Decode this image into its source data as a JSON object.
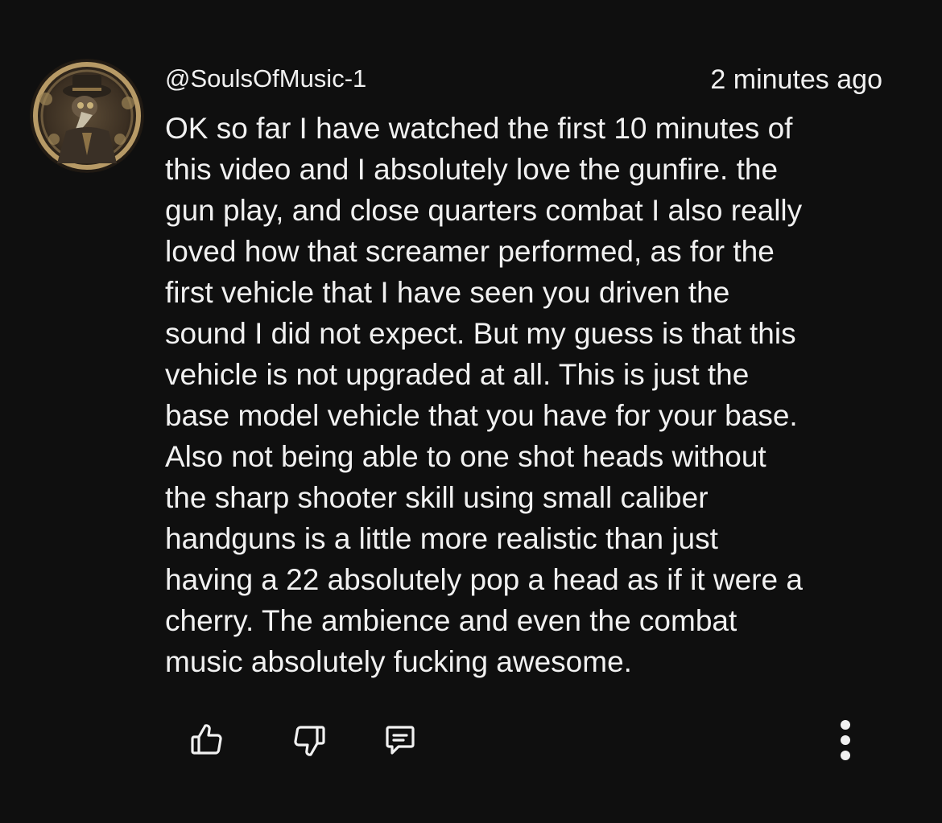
{
  "comment": {
    "author": "@SoulsOfMusic-1",
    "timestamp": "2 minutes ago",
    "avatar_icon": "plague-doctor-avatar-icon",
    "lines": [
      "OK so far I have watched the first 10 minutes of",
      "this video and I absolutely love the gunfire. the",
      "gun play, and close quarters combat I also really",
      "loved how that screamer performed, as for the",
      "first vehicle that I have seen you driven the",
      "sound I did not expect. But my guess is that this",
      "vehicle is not upgraded at all. This is just the",
      "base model vehicle that you have for your base.",
      "Also not being able to one shot heads without",
      "the sharp shooter skill using small caliber",
      "handguns is a little more realistic than just",
      "having a 22 absolutely pop a head as if it were a",
      "cherry. The ambience and even the combat",
      "music absolutely fucking awesome."
    ]
  },
  "actions": {
    "like_icon": "thumbs-up-icon",
    "dislike_icon": "thumbs-down-icon",
    "reply_icon": "reply-comment-icon",
    "more_icon": "more-vertical-icon"
  },
  "colors": {
    "background": "#0f0f0f",
    "text": "#f1f1f1"
  }
}
